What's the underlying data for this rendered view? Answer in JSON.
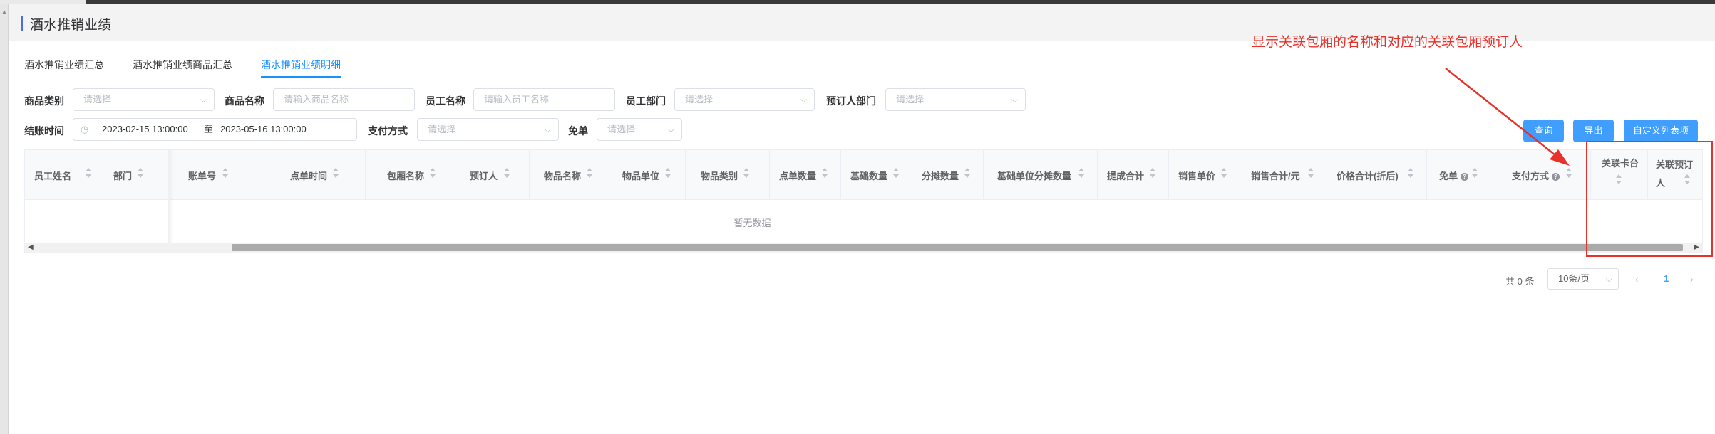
{
  "header": {
    "title": "酒水推销业绩"
  },
  "tabs": [
    {
      "label": "酒水推销业绩汇总",
      "active": false
    },
    {
      "label": "酒水推销业绩商品汇总",
      "active": false
    },
    {
      "label": "酒水推销业绩明细",
      "active": true
    }
  ],
  "filters": {
    "product_category": {
      "label": "商品类别",
      "placeholder": "请选择"
    },
    "product_name": {
      "label": "商品名称",
      "placeholder": "请输入商品名称"
    },
    "employee_name": {
      "label": "员工名称",
      "placeholder": "请输入员工名称"
    },
    "employee_dept": {
      "label": "员工部门",
      "placeholder": "请选择"
    },
    "booker_dept": {
      "label": "预订人部门",
      "placeholder": "请选择"
    },
    "checkout_time": {
      "label": "结账时间",
      "start": "2023-02-15 13:00:00",
      "separator": "至",
      "end": "2023-05-16 13:00:00"
    },
    "payment_method": {
      "label": "支付方式",
      "placeholder": "请选择"
    },
    "free_order": {
      "label": "免单",
      "placeholder": "请选择"
    }
  },
  "buttons": {
    "query": "查询",
    "export": "导出",
    "custom_columns": "自定义列表项"
  },
  "annotation": {
    "text": "显示关联包厢的名称和对应的关联包厢预订人",
    "color": "#e8312a"
  },
  "table": {
    "columns": [
      "员工姓名",
      "部门",
      "账单号",
      "点单时间",
      "包厢名称",
      "预订人",
      "物品名称",
      "物品单位",
      "物品类别",
      "点单数量",
      "基础数量",
      "分摊数量",
      "基础单位分摊数量",
      "提成合计",
      "销售单价",
      "销售合计/元",
      "价格合计(折后)",
      "免单",
      "支付方式",
      "关联卡台",
      "关联预订人"
    ],
    "empty_text": "暂无数据"
  },
  "pagination": {
    "total": "共 0 条",
    "page_size": "10条/页",
    "current_page": "1"
  },
  "colors": {
    "primary": "#409eff",
    "accent": "#4c6fe0",
    "annotation": "#e8312a"
  }
}
